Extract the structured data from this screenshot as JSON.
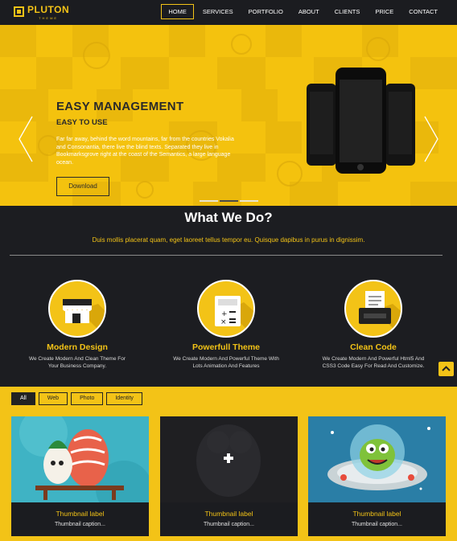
{
  "nav": {
    "logo_name": "PLUTON",
    "logo_sub": "THEME",
    "items": [
      {
        "label": "HOME",
        "active": true
      },
      {
        "label": "SERVICES"
      },
      {
        "label": "PORTFOLIO"
      },
      {
        "label": "ABOUT"
      },
      {
        "label": "CLIENTS"
      },
      {
        "label": "PRICE"
      },
      {
        "label": "CONTACT"
      }
    ]
  },
  "hero": {
    "title": "EASY MANAGEMENT",
    "subtitle": "EASY TO USE",
    "text": "Far far away, behind the word mountains, far from the countries Vokalia and Consonantia, there live the blind texts. Separated they live in Bookmarksgrove right at the coast of the Semantics, a large language ocean.",
    "button": "Download",
    "slide_count": 3,
    "active_slide": 2
  },
  "services": {
    "title": "What We Do?",
    "subtitle": "Duis mollis placerat quam, eget laoreet tellus tempor eu. Quisque dapibus in purus in dignissim.",
    "features": [
      {
        "icon": "store-icon",
        "title": "Modern Design",
        "desc": "We Create Modern And Clean Theme For Your Business Company."
      },
      {
        "icon": "calculator-icon",
        "title": "Powerfull Theme",
        "desc": "We Create Modern And Powerful Theme With Lots Animation And Features"
      },
      {
        "icon": "printer-icon",
        "title": "Clean Code",
        "desc": "We Create Modern And Powerful Html5 And CSS3 Code Easy For Read And Customize."
      }
    ]
  },
  "portfolio": {
    "filters": [
      {
        "label": "All",
        "active": true
      },
      {
        "label": "Web"
      },
      {
        "label": "Photo"
      },
      {
        "label": "Identity"
      }
    ],
    "items": [
      {
        "label": "Thumbnail label",
        "caption": "Thumbnail caption..."
      },
      {
        "label": "Thumbnail label",
        "caption": "Thumbnail caption..."
      },
      {
        "label": "Thumbnail label",
        "caption": "Thumbnail caption..."
      }
    ]
  },
  "colors": {
    "accent": "#f3c317",
    "dark": "#1b1c20"
  }
}
